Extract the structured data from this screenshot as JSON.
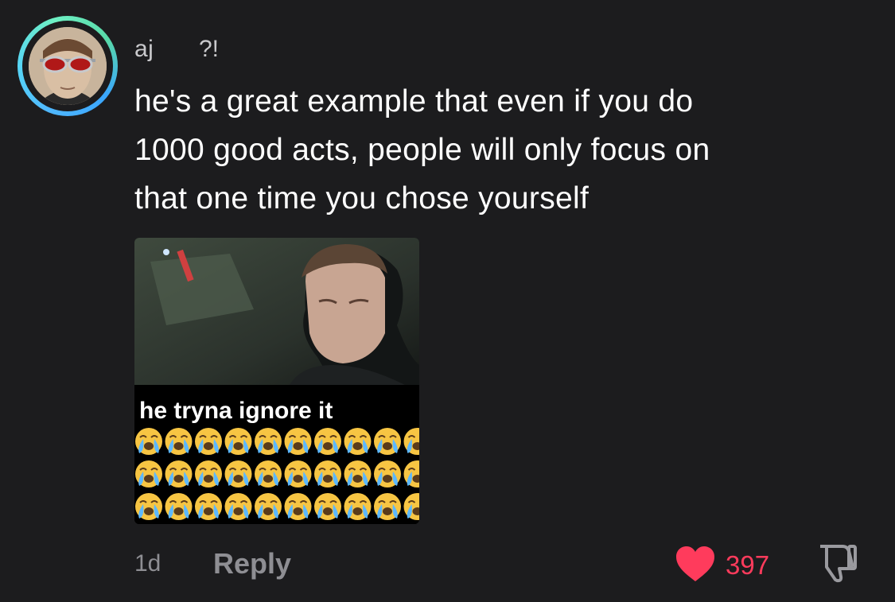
{
  "comment": {
    "username": "aj",
    "user_tag": "?!",
    "text_lines": [
      "he's a great example that even if you do",
      "1000 good acts, people will only focus on",
      "that one time you chose yourself"
    ],
    "attachment_caption": "he tryna ignore it",
    "time_ago": "1d",
    "reply_label": "Reply",
    "like_count": "397"
  },
  "icons": {
    "like": "heart-icon",
    "dislike": "thumbs-down-icon"
  },
  "colors": {
    "background": "#1c1c1e",
    "like": "#ff3b5c",
    "muted": "#8e8e93"
  }
}
